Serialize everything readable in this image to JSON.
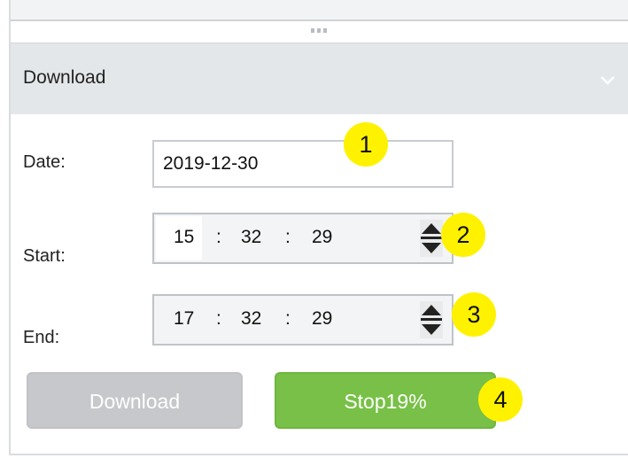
{
  "panel": {
    "title": "Download",
    "collapse_icon": "chevron-down-icon"
  },
  "form": {
    "date_label": "Date:",
    "date_value": "2019-12-30",
    "start_label": "Start:",
    "start_hour": "15",
    "start_minute": "32",
    "start_second": "29",
    "end_label": "End:",
    "end_hour": "17",
    "end_minute": "32",
    "end_second": "29",
    "separator": ":"
  },
  "buttons": {
    "download_label": "Download",
    "stop_label": "Stop19%"
  },
  "callouts": [
    "1",
    "2",
    "3",
    "4"
  ],
  "colors": {
    "callout": "#fff200",
    "stop_button": "#78c047",
    "download_button_disabled": "#c6c8cb",
    "header_bg": "#e4e7ea"
  }
}
